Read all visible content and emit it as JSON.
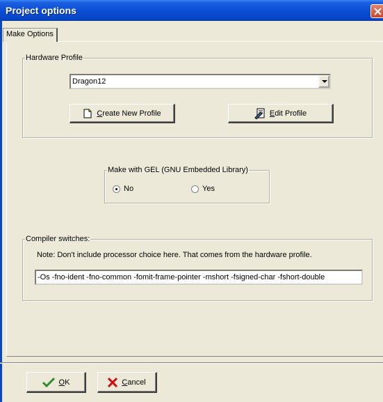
{
  "window": {
    "title": "Project options"
  },
  "tabs": [
    {
      "label": "Make Options"
    }
  ],
  "hardware": {
    "group_label": "Hardware Profile",
    "selected_profile": "Dragon12",
    "create_label": "Create New Profile",
    "edit_label": "Edit Profile"
  },
  "gel": {
    "group_label": "Make with GEL (GNU Embedded Library)",
    "options": [
      {
        "label": "No",
        "selected": true
      },
      {
        "label": "Yes",
        "selected": false
      }
    ]
  },
  "compiler": {
    "group_label": "Compiler switches:",
    "note": "Note: Don't include processor choice here. That comes from the hardware profile.",
    "switches": "-Os -fno-ident -fno-common -fomit-frame-pointer -mshort -fsigned-char -fshort-double"
  },
  "footer": {
    "ok_label": "OK",
    "cancel_label": "Cancel"
  },
  "icons": {
    "close": "close-icon",
    "dropdown": "chevron-down-icon",
    "create": "new-document-icon",
    "edit": "edit-document-icon",
    "ok": "check-icon",
    "cancel": "x-icon"
  }
}
